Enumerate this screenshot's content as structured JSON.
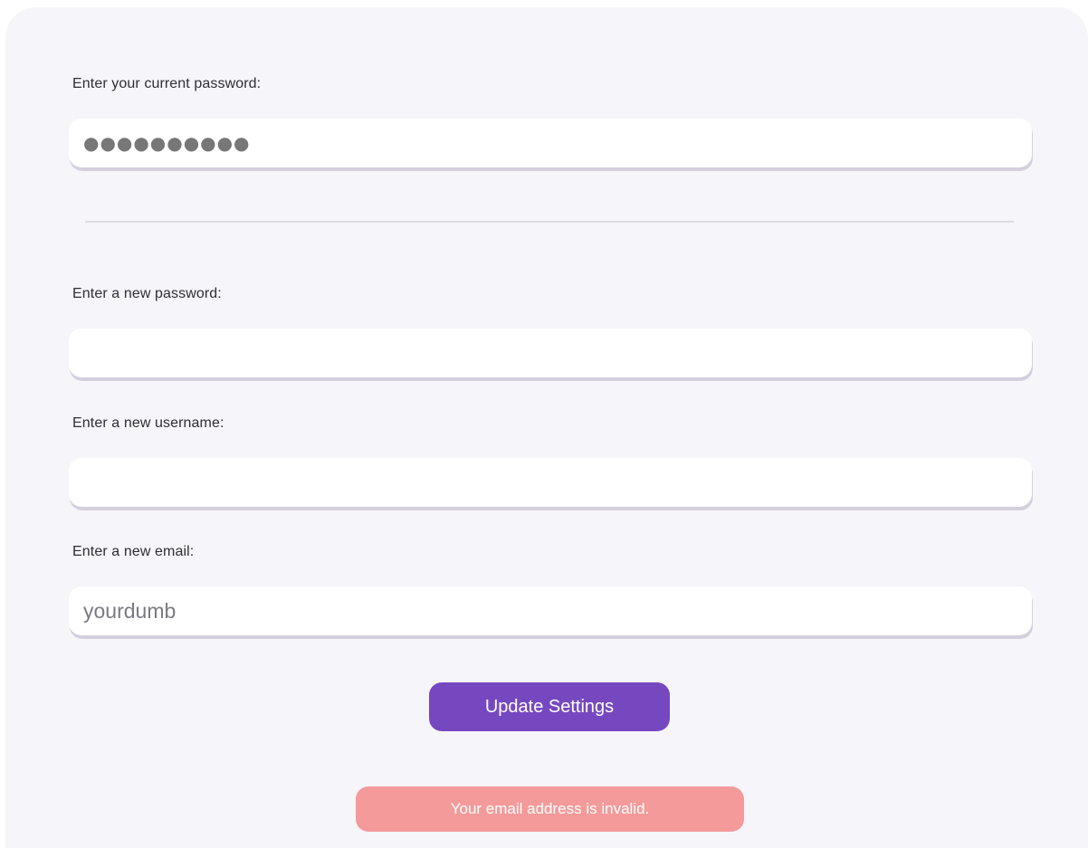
{
  "form": {
    "current_password": {
      "label": "Enter your current password:",
      "masked_value": "●●●●●●●●●●"
    },
    "new_password": {
      "label": "Enter a new password:",
      "value": ""
    },
    "new_username": {
      "label": "Enter a new username:",
      "value": ""
    },
    "new_email": {
      "label": "Enter a new email:",
      "value": "yourdumb"
    },
    "submit_label": "Update Settings",
    "error_message": "Your email address is invalid."
  },
  "colors": {
    "panel_bg": "#f6f5f9",
    "button_bg": "#7648c0",
    "error_bg": "#f49a9a",
    "field_shadow": "#d4cfdd"
  }
}
